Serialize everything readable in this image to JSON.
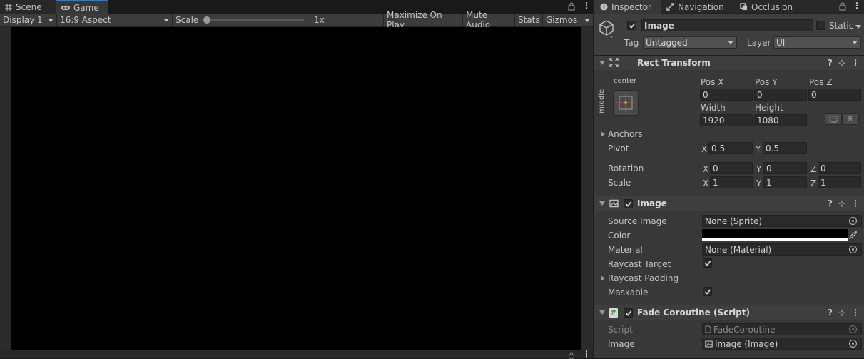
{
  "left": {
    "tabs": [
      {
        "label": "Scene",
        "icon": "grid-icon"
      },
      {
        "label": "Game",
        "icon": "gamepad-icon"
      }
    ],
    "toolbar": {
      "display": "Display 1",
      "aspect": "16:9 Aspect",
      "scale_label": "Scale",
      "scale_value": "1x",
      "maximize": "Maximize On Play",
      "mute": "Mute Audio",
      "stats": "Stats",
      "gizmos": "Gizmos"
    }
  },
  "inspector": {
    "tabs": [
      {
        "label": "Inspector",
        "icon": "info-icon"
      },
      {
        "label": "Navigation",
        "icon": "navigation-icon"
      },
      {
        "label": "Occlusion",
        "icon": "occlusion-icon"
      }
    ],
    "object": {
      "name": "Image",
      "static_label": "Static",
      "tag_label": "Tag",
      "tag_value": "Untagged",
      "layer_label": "Layer",
      "layer_value": "UI"
    },
    "rect_transform": {
      "title": "Rect Transform",
      "anchor_h": "center",
      "anchor_v": "middle",
      "pos_x_label": "Pos X",
      "pos_x": "0",
      "pos_y_label": "Pos Y",
      "pos_y": "0",
      "pos_z_label": "Pos Z",
      "pos_z": "0",
      "width_label": "Width",
      "width": "1920",
      "height_label": "Height",
      "height": "1080",
      "r_button": "R",
      "anchors_label": "Anchors",
      "pivot_label": "Pivot",
      "pivot_x": "0.5",
      "pivot_y": "0.5",
      "rotation_label": "Rotation",
      "rot_x": "0",
      "rot_y": "0",
      "rot_z": "0",
      "scale_label": "Scale",
      "scale_x": "1",
      "scale_y": "1",
      "scale_z": "1",
      "x": "X",
      "y": "Y",
      "z": "Z"
    },
    "image": {
      "title": "Image",
      "source_label": "Source Image",
      "source_value": "None (Sprite)",
      "color_label": "Color",
      "color": "#000000",
      "material_label": "Material",
      "material_value": "None (Material)",
      "raycast_label": "Raycast Target",
      "raycast_padding_label": "Raycast Padding",
      "maskable_label": "Maskable"
    },
    "script": {
      "title": "Fade Coroutine (Script)",
      "script_label": "Script",
      "script_value": "FadeCoroutine",
      "image_label": "Image",
      "image_value": "Image (Image)"
    }
  }
}
